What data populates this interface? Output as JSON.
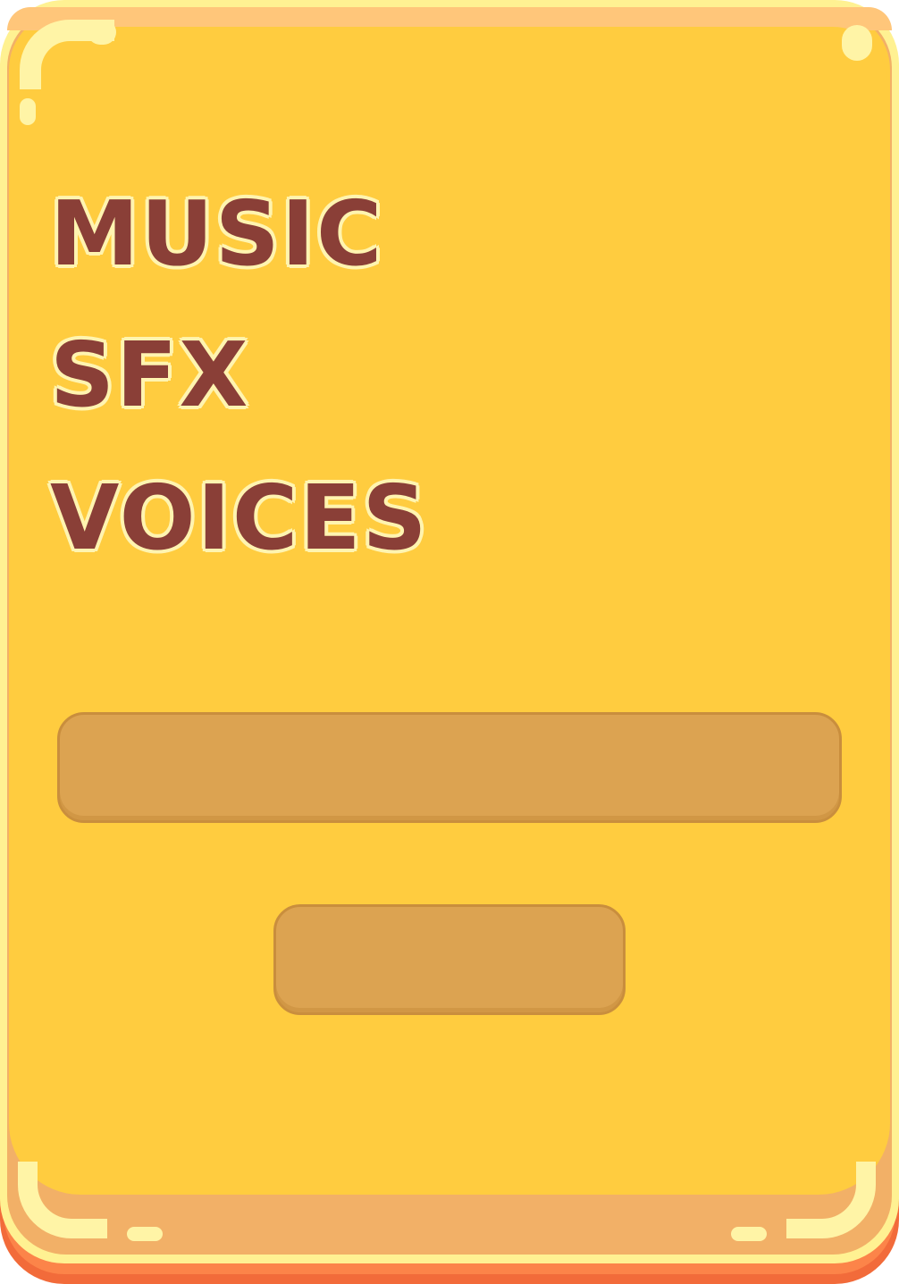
{
  "panel": {
    "colors": {
      "face": "#ffcc3f",
      "rim": "#fff192",
      "body": "#f2b067",
      "shadow": "#fc8449",
      "label_text": "#8a3f37",
      "slot": "#dca351"
    }
  },
  "settings": {
    "items": [
      {
        "label": "MUSIC"
      },
      {
        "label": "SFX"
      },
      {
        "label": "VOICES"
      }
    ]
  }
}
